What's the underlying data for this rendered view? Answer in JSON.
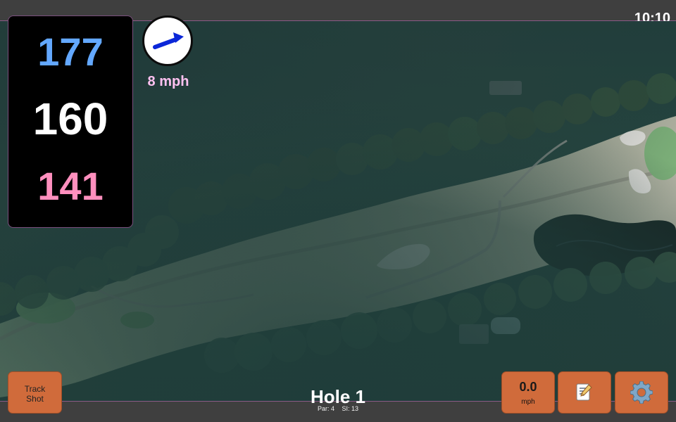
{
  "status_bar": {
    "time": "10:10"
  },
  "distances": {
    "back": "177",
    "middle": "160",
    "front": "141"
  },
  "wind": {
    "speed_label": "8 mph",
    "arrow_icon": "wind-arrow-icon",
    "arrow_color": "#0b27d8"
  },
  "buttons": {
    "track_shot_line1": "Track",
    "track_shot_line2": "Shot",
    "speed_value": "0.0",
    "speed_unit": "mph",
    "notes_icon": "notes-icon",
    "settings_icon": "settings-icon"
  },
  "hole": {
    "title": "Hole 1",
    "par": "Par: 4",
    "si": "SI: 13"
  },
  "colors": {
    "back_distance": "#63a8ff",
    "middle_distance": "#ffffff",
    "front_distance": "#ff8fbe",
    "button": "#d06b3b",
    "accent_border": "#8b5a86"
  }
}
